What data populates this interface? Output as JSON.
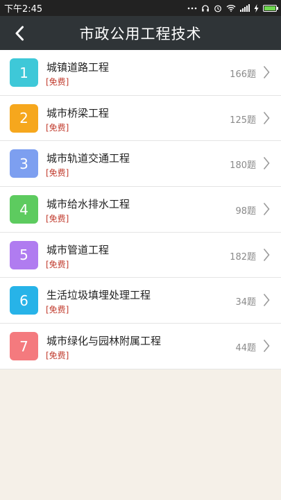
{
  "status_bar": {
    "time": "下午2:45"
  },
  "header": {
    "title": "市政公用工程技术",
    "back_icon": "chevron-left-icon"
  },
  "courses": [
    {
      "number": "1",
      "title": "城镇道路工程",
      "tag": "[免费]",
      "count": "166题",
      "color": "#3ec8d8"
    },
    {
      "number": "2",
      "title": "城市桥梁工程",
      "tag": "[免费]",
      "count": "125题",
      "color": "#f6a71d"
    },
    {
      "number": "3",
      "title": "城市轨道交通工程",
      "tag": "[免费]",
      "count": "180题",
      "color": "#7d9ff0"
    },
    {
      "number": "4",
      "title": "城市给水排水工程",
      "tag": "[免费]",
      "count": "98题",
      "color": "#5dcb5f"
    },
    {
      "number": "5",
      "title": "城市管道工程",
      "tag": "[免费]",
      "count": "182题",
      "color": "#b07cf0"
    },
    {
      "number": "6",
      "title": "生活垃圾填埋处理工程",
      "tag": "[免费]",
      "count": "34题",
      "color": "#27b3e8"
    },
    {
      "number": "7",
      "title": "城市绿化与园林附属工程",
      "tag": "[免费]",
      "count": "44题",
      "color": "#f47a7e"
    }
  ]
}
